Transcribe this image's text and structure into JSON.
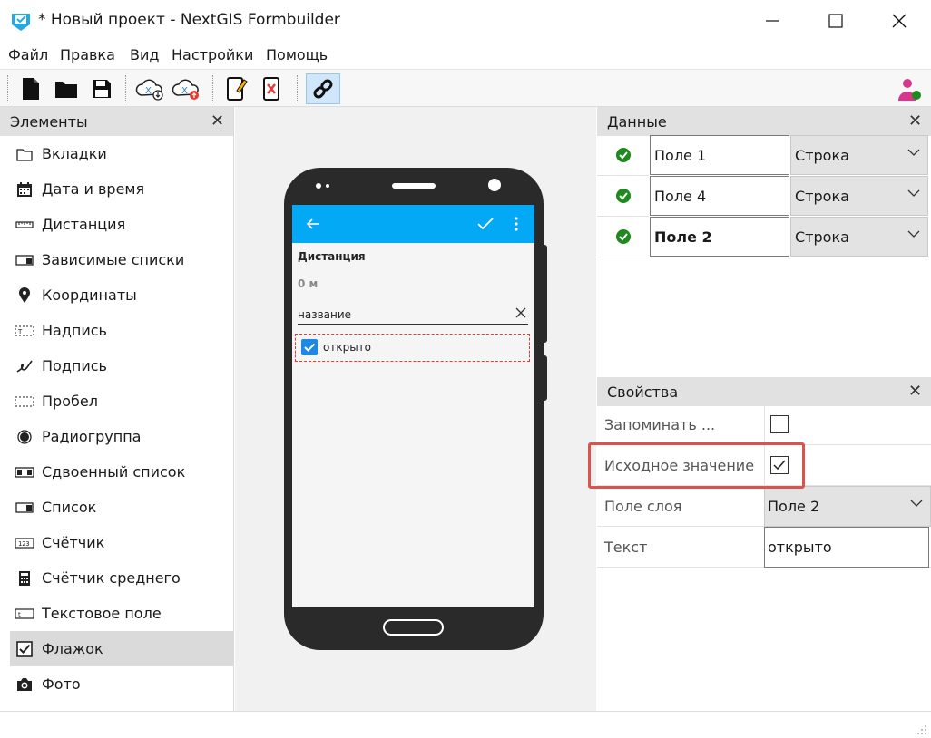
{
  "window": {
    "title": "* Новый проект - NextGIS Formbuilder"
  },
  "menu": [
    "Файл",
    "Правка",
    "Вид",
    "Настройки",
    "Помощь"
  ],
  "toolbar": {
    "icons": [
      "new-file-icon",
      "open-folder-icon",
      "save-icon",
      "cloud-download-icon",
      "cloud-upload-icon",
      "device-edit-icon",
      "device-delete-icon",
      "link-icon",
      "user-icon"
    ]
  },
  "elements_panel": {
    "title": "Элементы",
    "items": [
      {
        "label": "Вкладки",
        "icon": "tabs-icon"
      },
      {
        "label": "Дата и время",
        "icon": "calendar-icon"
      },
      {
        "label": "Дистанция",
        "icon": "ruler-icon"
      },
      {
        "label": "Зависимые списки",
        "icon": "dependent-list-icon"
      },
      {
        "label": "Координаты",
        "icon": "location-pin-icon"
      },
      {
        "label": "Надпись",
        "icon": "label-icon"
      },
      {
        "label": "Подпись",
        "icon": "signature-icon"
      },
      {
        "label": "Пробел",
        "icon": "space-icon"
      },
      {
        "label": "Радиогруппа",
        "icon": "radio-icon"
      },
      {
        "label": "Сдвоенный список",
        "icon": "double-list-icon"
      },
      {
        "label": "Список",
        "icon": "list-icon"
      },
      {
        "label": "Счётчик",
        "icon": "counter-icon"
      },
      {
        "label": "Счётчик среднего",
        "icon": "calculator-icon"
      },
      {
        "label": "Текстовое поле",
        "icon": "text-field-icon"
      },
      {
        "label": "Флажок",
        "icon": "checkbox-icon"
      },
      {
        "label": "Фото",
        "icon": "camera-icon"
      }
    ],
    "selected_index": 14
  },
  "phone_preview": {
    "distance_title": "Дистанция",
    "distance_value": "0 м",
    "input_placeholder": "название",
    "checkbox_label": "открыто"
  },
  "data_panel": {
    "title": "Данные",
    "rows": [
      {
        "field": "Поле 1",
        "type": "Строка",
        "bold": false
      },
      {
        "field": "Поле 4",
        "type": "Строка",
        "bold": false
      },
      {
        "field": "Поле 2",
        "type": "Строка",
        "bold": true
      }
    ]
  },
  "props_panel": {
    "title": "Свойства",
    "remember_label": "Запоминать ...",
    "default_label": "Исходное значение",
    "default_checked": true,
    "layer_field_label": "Поле слоя",
    "layer_field_value": "Поле 2",
    "text_label": "Текст",
    "text_value": "открыто"
  },
  "colors": {
    "accent_blue": "#03a9f4",
    "highlight_red": "#d9534f",
    "check_green": "#1e8a1e"
  }
}
